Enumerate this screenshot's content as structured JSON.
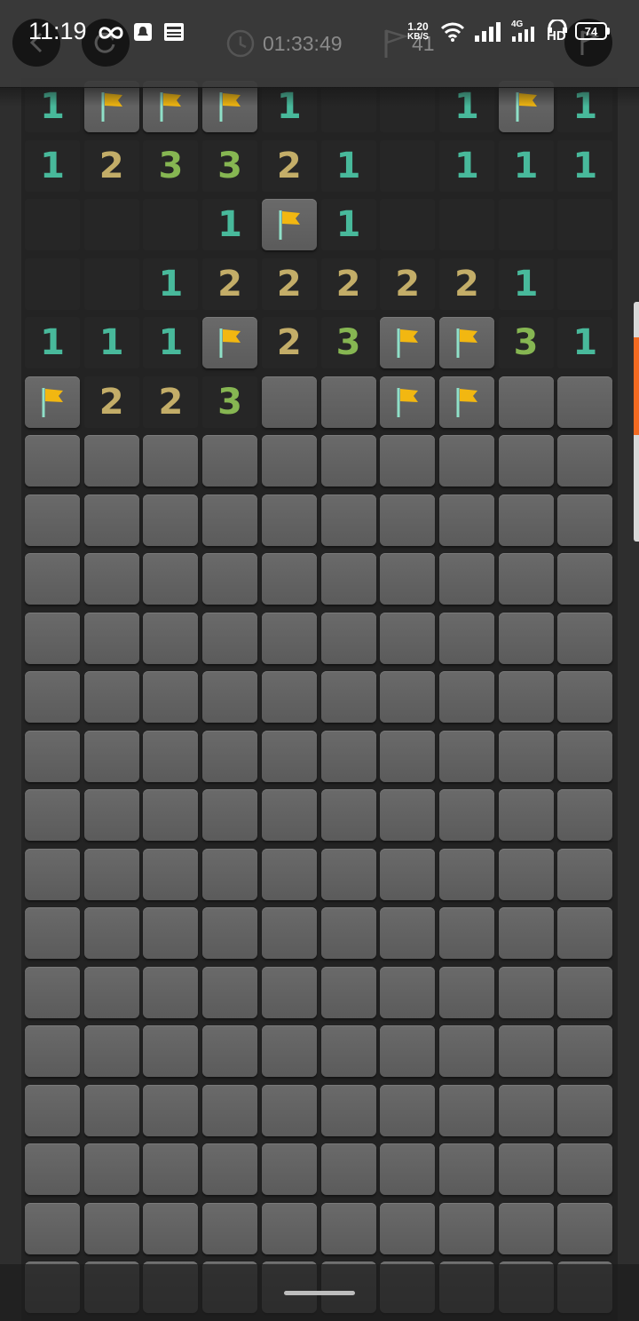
{
  "status_bar": {
    "time": "11:19",
    "net_speed_value": "1.20",
    "net_speed_unit": "KB/S",
    "network_type": "4G",
    "hd_label": "HD",
    "battery": "74"
  },
  "header": {
    "timer": "01:33:49",
    "mine_count": "41"
  },
  "colors": {
    "one": "#48b99b",
    "two": "#c3ad68",
    "three": "#86b652",
    "flag": "#f2b711",
    "scroll_accent": "#f26a21"
  },
  "board": {
    "columns": 10,
    "rows": 21,
    "top_rows": [
      [
        "1",
        "F",
        "F",
        "F",
        "1",
        "",
        "",
        "1",
        "F",
        "1"
      ],
      [
        "1",
        "2",
        "3",
        "3",
        "2",
        "1",
        "",
        "1",
        "1",
        "1"
      ],
      [
        "",
        "",
        "",
        "1",
        "F",
        "1",
        "",
        "",
        "",
        ""
      ],
      [
        "",
        "",
        "1",
        "2",
        "2",
        "2",
        "2",
        "2",
        "1",
        ""
      ],
      [
        "1",
        "1",
        "1",
        "F",
        "2",
        "3",
        "F",
        "F",
        "3",
        "1"
      ],
      [
        "F",
        "2",
        "2",
        "3",
        "#",
        "#",
        "F",
        "F",
        "#",
        "#"
      ]
    ]
  }
}
